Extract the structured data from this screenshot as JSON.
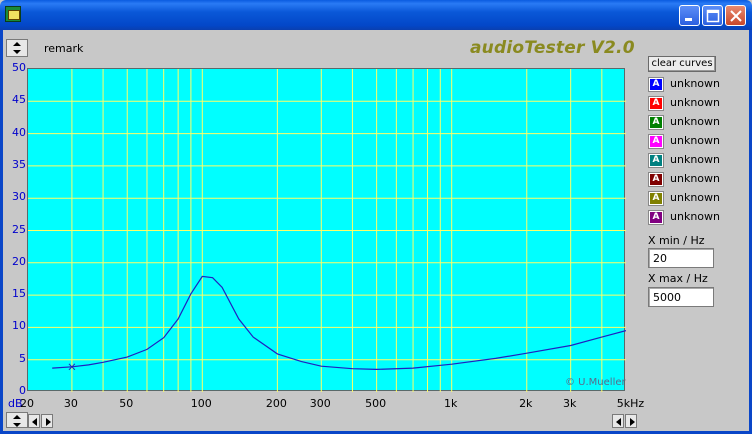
{
  "window": {
    "controls": [
      "minimize",
      "maximize",
      "close"
    ]
  },
  "toolbar": {
    "remark": "remark",
    "brand": "audioTester V2.0"
  },
  "plot": {
    "credit": "© U.Mueller",
    "db_unit": "dB",
    "colors": {
      "background": "#00ffff",
      "grid": "#ffff66",
      "curve": "#2020c0"
    }
  },
  "chart_data": {
    "type": "line",
    "title": "",
    "xlabel": "",
    "ylabel": "dB",
    "x_scale": "log",
    "xlim": [
      20,
      5000
    ],
    "ylim": [
      0,
      50
    ],
    "x_tick_labels": [
      "20",
      "30",
      "50",
      "100",
      "200",
      "300",
      "500",
      "1k",
      "2k",
      "3k",
      "5kHz"
    ],
    "x_tick_values": [
      20,
      30,
      50,
      100,
      200,
      300,
      500,
      1000,
      2000,
      3000,
      5000
    ],
    "y_tick_labels": [
      "0",
      "5",
      "10",
      "15",
      "20",
      "25",
      "30",
      "35",
      "40",
      "45",
      "50"
    ],
    "grid": true,
    "series": [
      {
        "color": "#2020c0",
        "x": [
          25,
          30,
          35,
          40,
          50,
          60,
          70,
          80,
          90,
          100,
          110,
          120,
          140,
          160,
          200,
          250,
          300,
          400,
          500,
          700,
          1000,
          1500,
          2000,
          3000,
          4000,
          5000
        ],
        "y": [
          3.7,
          3.9,
          4.2,
          4.6,
          5.4,
          6.6,
          8.4,
          11.3,
          15.2,
          17.9,
          17.7,
          16.2,
          11.3,
          8.5,
          5.9,
          4.7,
          4.0,
          3.6,
          3.5,
          3.7,
          4.3,
          5.2,
          6.0,
          7.2,
          8.5,
          9.5
        ]
      }
    ],
    "markers": [
      {
        "x": 30,
        "y": 3.9,
        "symbol": "x"
      }
    ]
  },
  "legend": {
    "clear_label": "clear curves",
    "items": [
      {
        "label": "unknown",
        "color": "#0000ff"
      },
      {
        "label": "unknown",
        "color": "#ff0000"
      },
      {
        "label": "unknown",
        "color": "#008000"
      },
      {
        "label": "unknown",
        "color": "#ff00ff"
      },
      {
        "label": "unknown",
        "color": "#008080"
      },
      {
        "label": "unknown",
        "color": "#800000"
      },
      {
        "label": "unknown",
        "color": "#808000"
      },
      {
        "label": "unknown",
        "color": "#800080"
      }
    ],
    "swatch_glyph": "A"
  },
  "range": {
    "xmin_label": "X min / Hz",
    "xmin_value": "20",
    "xmax_label": "X max / Hz",
    "xmax_value": "5000"
  }
}
